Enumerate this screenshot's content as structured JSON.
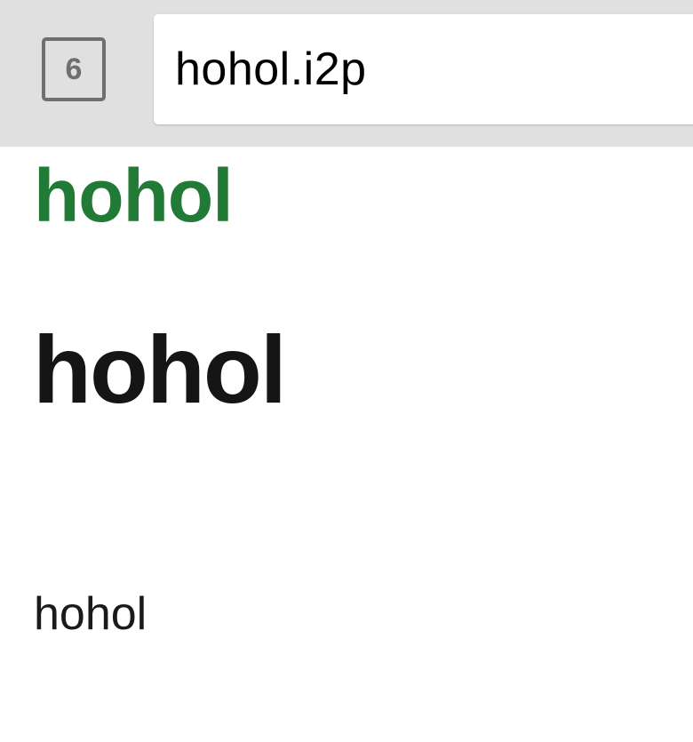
{
  "browser": {
    "tab_count": "6",
    "url": "hohol.i2p"
  },
  "page": {
    "site_title": "hohol",
    "heading": "hohol",
    "body_text": "hohol"
  },
  "colors": {
    "toolbar_background": "#e0e0e0",
    "site_title": "#217a36",
    "heading": "#151515"
  },
  "icons": {
    "tab_switcher": "tab-switcher-icon"
  }
}
